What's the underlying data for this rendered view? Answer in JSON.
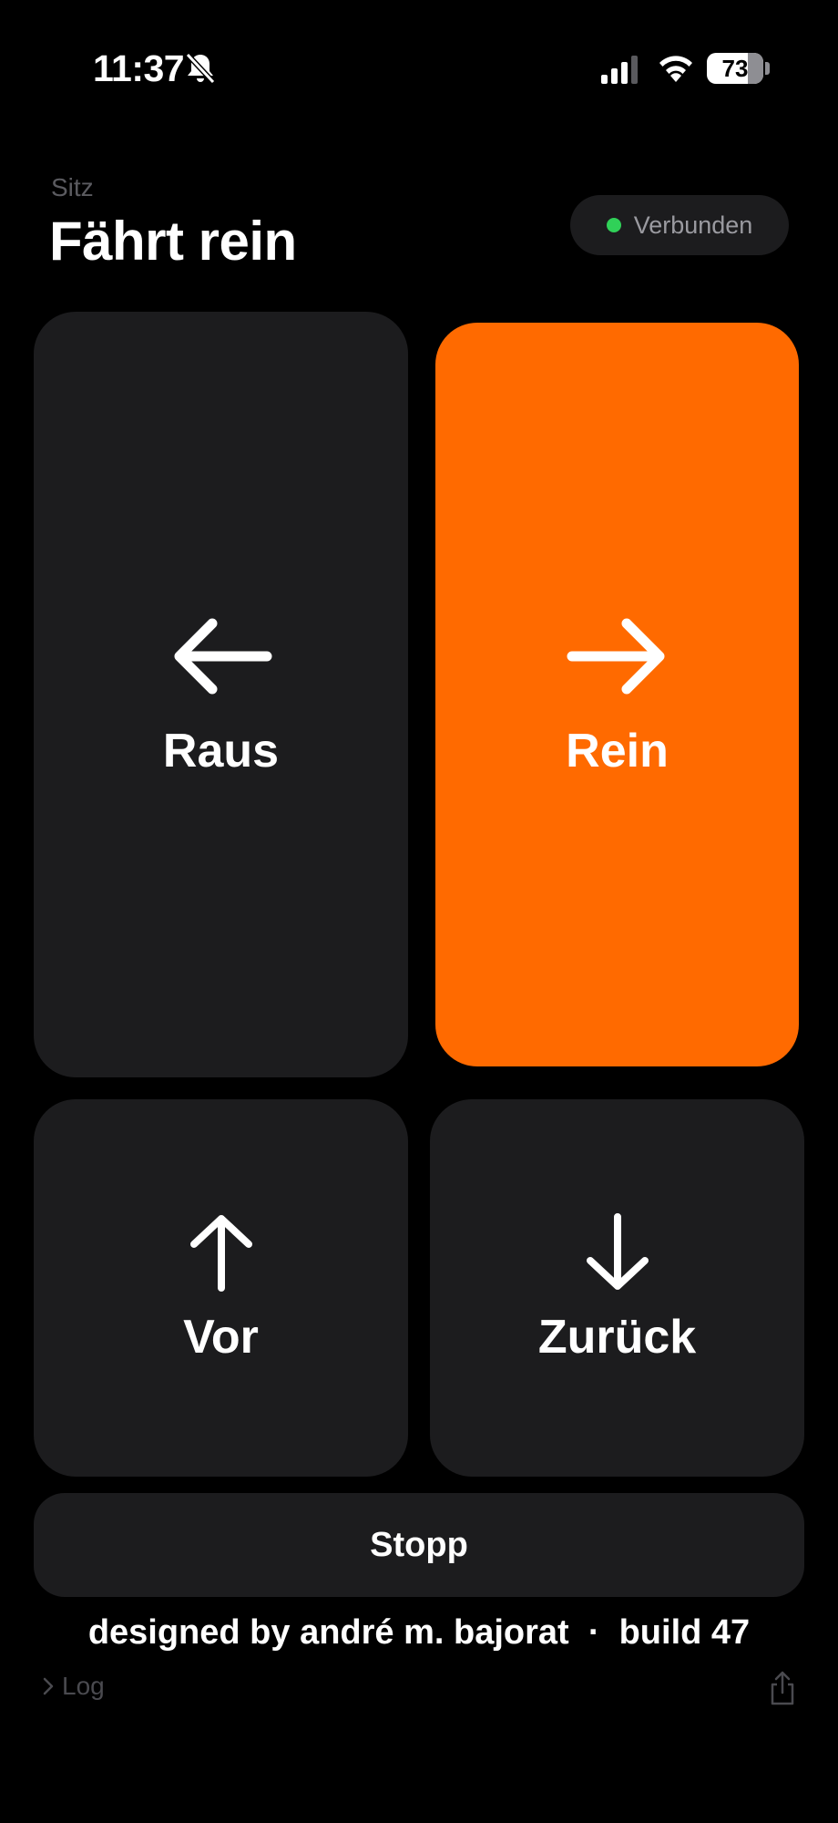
{
  "status": {
    "time": "11:37",
    "icons": [
      "bell-slash-icon",
      "cellular-signal-icon",
      "wifi-icon"
    ],
    "battery_percent": "73",
    "battery_level": 0.73
  },
  "header": {
    "subtitle": "Sitz",
    "title": "Fährt rein",
    "connection": {
      "label": "Verbunden",
      "color": "#30d158"
    }
  },
  "controls": {
    "raus": {
      "label": "Raus",
      "icon": "arrow-left-icon"
    },
    "rein": {
      "label": "Rein",
      "icon": "arrow-right-icon",
      "active": true,
      "color": "#ff6a00"
    },
    "vor": {
      "label": "Vor",
      "icon": "arrow-up-icon"
    },
    "zurueck": {
      "label": "Zurück",
      "icon": "arrow-down-icon"
    },
    "stop": {
      "label": "Stopp"
    }
  },
  "footer": {
    "credit": "designed by andré m. bajorat  ·  build 47",
    "log_label": "Log",
    "icons": [
      "chevron-right-icon",
      "share-icon"
    ]
  }
}
